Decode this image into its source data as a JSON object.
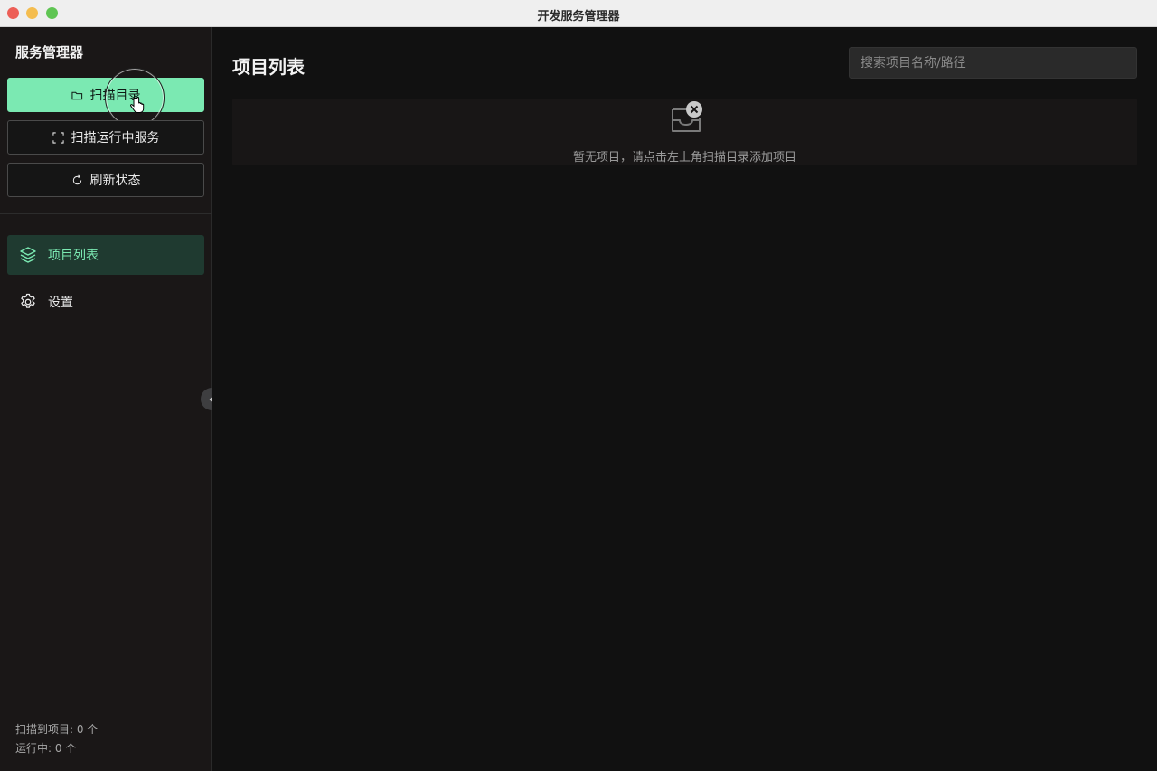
{
  "window": {
    "title": "开发服务管理器"
  },
  "sidebar": {
    "brand": "服务管理器",
    "buttons": {
      "scan_dir": "扫描目录",
      "scan_running": "扫描运行中服务",
      "refresh": "刷新状态"
    },
    "nav": [
      {
        "label": "项目列表",
        "icon": "layers-icon",
        "active": true
      },
      {
        "label": "设置",
        "icon": "gear-icon",
        "active": false
      }
    ],
    "stats": {
      "scanned": "扫描到项目: 0 个",
      "running": "运行中: 0 个"
    }
  },
  "main": {
    "title": "项目列表",
    "search_placeholder": "搜索项目名称/路径",
    "empty_text": "暂无项目，请点击左上角扫描目录添加项目"
  },
  "colors": {
    "accent": "#7be9b2",
    "active_nav_bg": "#1f3a30",
    "sidebar_bg": "#1a1717",
    "main_bg": "#111111"
  }
}
